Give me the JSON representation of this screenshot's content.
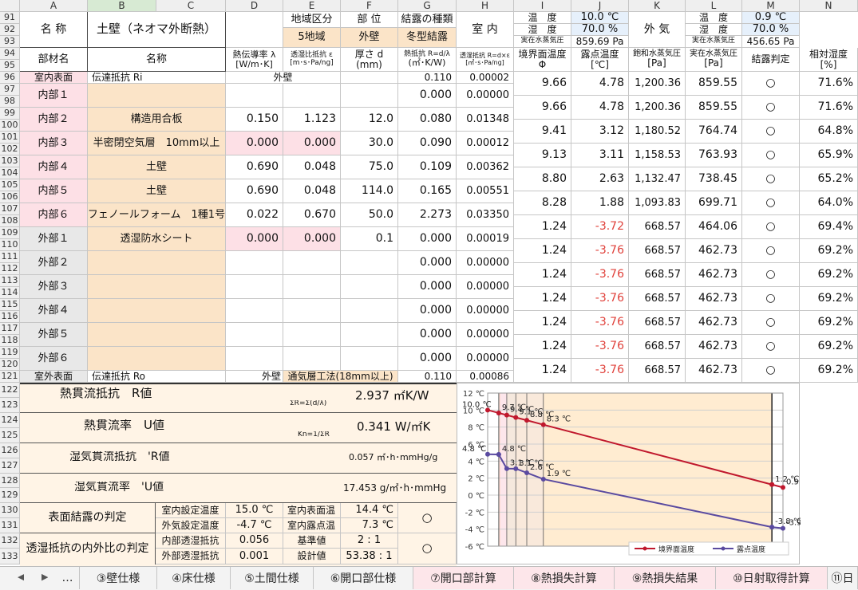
{
  "columns": [
    "A",
    "B",
    "C",
    "D",
    "E",
    "F",
    "G",
    "H",
    "I",
    "J",
    "K",
    "L",
    "M",
    "N"
  ],
  "rows": [
    "91",
    "92",
    "93",
    "94",
    "95",
    "96",
    "97",
    "98",
    "99",
    "100",
    "101",
    "102",
    "103",
    "104",
    "105",
    "106",
    "107",
    "108",
    "109",
    "110",
    "111",
    "112",
    "113",
    "114",
    "115",
    "116",
    "117",
    "118",
    "119",
    "120",
    "121",
    "122",
    "123",
    "124",
    "125",
    "126",
    "127",
    "128",
    "129",
    "130",
    "131",
    "132",
    "133"
  ],
  "header": {
    "name_label": "名 称",
    "wall_name": "土壁（ネオマ外断熱）",
    "region_label": "地域区分",
    "region_value": "5地域",
    "part_label": "部 位",
    "part_value": "外壁",
    "cond_label": "結露の種類",
    "cond_value": "冬型結露",
    "indoor_label": "室 内",
    "indoor_temp_label": "温　度",
    "indoor_temp": "10.0 ℃",
    "indoor_hum_label": "湿　度",
    "indoor_hum": "70.0 %",
    "indoor_vp_label": "実在水蒸気圧",
    "indoor_vp": "859.69 Pa",
    "outdoor_label": "外 気",
    "outdoor_temp_label": "温　度",
    "outdoor_temp": "0.9 ℃",
    "outdoor_hum_label": "湿　度",
    "outdoor_hum": "70.0 %",
    "outdoor_vp_label": "実在水蒸気圧",
    "outdoor_vp": "456.65 Pa"
  },
  "colheads": {
    "member": "部材名",
    "name": "名称",
    "cond1": "熱伝導率 λ",
    "cond2": "[W/m･K]",
    "perm1": "透湿比抵抗 ε",
    "perm2": "[m･s･Pa/ng]",
    "thick1": "厚さ d",
    "thick2": "(mm)",
    "tr1": "熱抵抗 R=d/λ",
    "tr2": "(㎡･K/W)",
    "mr1": "透湿抵抗 R=d×ε",
    "mr2": "[㎡･s･Pa/ng]",
    "itemp1": "境界面温度",
    "itemp2": "Φ",
    "dew1": "露点温度",
    "dew2": "[℃]",
    "sat1": "飽和水蒸気圧",
    "sat2": "[Pa]",
    "act1": "実在水蒸気圧",
    "act2": "[Pa]",
    "judge": "結露判定",
    "rh1": "相対湿度",
    "rh2": "[%]"
  },
  "surf_in": {
    "label": "室内表面",
    "name": "伝達抵抗 Ri",
    "part": "外壁",
    "g": "0.110",
    "h": "0.00002"
  },
  "surf_out": {
    "label": "室外表面",
    "name": "伝達抵抗 Ro",
    "part": "外壁",
    "method": "通気層工法(18mm以上)",
    "g": "0.110",
    "h": "0.00086"
  },
  "materials": [
    {
      "label": "内部１",
      "name": "",
      "d": "",
      "e": "",
      "f": "",
      "g": "0.000",
      "h": "0.00000"
    },
    {
      "label": "内部２",
      "name": "構造用合板",
      "d": "0.150",
      "e": "1.123",
      "f": "12.0",
      "g": "0.080",
      "h": "0.01348"
    },
    {
      "label": "内部３",
      "name": "半密閉空気層　10mm以上",
      "d": "0.000",
      "e": "0.000",
      "f": "30.0",
      "g": "0.090",
      "h": "0.00012"
    },
    {
      "label": "内部４",
      "name": "土壁",
      "d": "0.690",
      "e": "0.048",
      "f": "75.0",
      "g": "0.109",
      "h": "0.00362"
    },
    {
      "label": "内部５",
      "name": "土壁",
      "d": "0.690",
      "e": "0.048",
      "f": "114.0",
      "g": "0.165",
      "h": "0.00551"
    },
    {
      "label": "内部６",
      "name": "フェノールフォーム　1種1号",
      "d": "0.022",
      "e": "0.670",
      "f": "50.0",
      "g": "2.273",
      "h": "0.03350"
    },
    {
      "label": "外部１",
      "name": "透湿防水シート",
      "d": "0.000",
      "e": "0.000",
      "f": "0.1",
      "g": "0.000",
      "h": "0.00019"
    },
    {
      "label": "外部２",
      "name": "",
      "d": "",
      "e": "",
      "f": "",
      "g": "0.000",
      "h": "0.00000"
    },
    {
      "label": "外部３",
      "name": "",
      "d": "",
      "e": "",
      "f": "",
      "g": "0.000",
      "h": "0.00000"
    },
    {
      "label": "外部４",
      "name": "",
      "d": "",
      "e": "",
      "f": "",
      "g": "0.000",
      "h": "0.00000"
    },
    {
      "label": "外部５",
      "name": "",
      "d": "",
      "e": "",
      "f": "",
      "g": "0.000",
      "h": "0.00000"
    },
    {
      "label": "外部６",
      "name": "",
      "d": "",
      "e": "",
      "f": "",
      "g": "0.000",
      "h": "0.00000"
    }
  ],
  "results": [
    {
      "i": "9.66",
      "j": "4.78",
      "k": "1,200.36",
      "l": "859.55",
      "m": "○",
      "n": "71.6%"
    },
    {
      "i": "9.66",
      "j": "4.78",
      "k": "1,200.36",
      "l": "859.55",
      "m": "○",
      "n": "71.6%"
    },
    {
      "i": "9.41",
      "j": "3.12",
      "k": "1,180.52",
      "l": "764.74",
      "m": "○",
      "n": "64.8%"
    },
    {
      "i": "9.13",
      "j": "3.11",
      "k": "1,158.53",
      "l": "763.93",
      "m": "○",
      "n": "65.9%"
    },
    {
      "i": "8.80",
      "j": "2.63",
      "k": "1,132.47",
      "l": "738.45",
      "m": "○",
      "n": "65.2%"
    },
    {
      "i": "8.28",
      "j": "1.88",
      "k": "1,093.83",
      "l": "699.71",
      "m": "○",
      "n": "64.0%"
    },
    {
      "i": "1.24",
      "j": "-3.72",
      "k": "668.57",
      "l": "464.06",
      "m": "○",
      "n": "69.4%"
    },
    {
      "i": "1.24",
      "j": "-3.76",
      "k": "668.57",
      "l": "462.73",
      "m": "○",
      "n": "69.2%"
    },
    {
      "i": "1.24",
      "j": "-3.76",
      "k": "668.57",
      "l": "462.73",
      "m": "○",
      "n": "69.2%"
    },
    {
      "i": "1.24",
      "j": "-3.76",
      "k": "668.57",
      "l": "462.73",
      "m": "○",
      "n": "69.2%"
    },
    {
      "i": "1.24",
      "j": "-3.76",
      "k": "668.57",
      "l": "462.73",
      "m": "○",
      "n": "69.2%"
    },
    {
      "i": "1.24",
      "j": "-3.76",
      "k": "668.57",
      "l": "462.73",
      "m": "○",
      "n": "69.2%"
    },
    {
      "i": "1.24",
      "j": "-3.76",
      "k": "668.57",
      "l": "462.73",
      "m": "○",
      "n": "69.2%"
    }
  ],
  "summary": {
    "r_label": "熱貫流抵抗　R値",
    "r_formula": "ΣR=Σ(d/λ)",
    "r_value": "2.937 ㎡K/W",
    "u_label": "熱貫流率　U値",
    "u_formula": "Kn=1/ΣR",
    "u_value": "0.341 W/㎡K",
    "rr_label": "湿気貫流抵抗　'R値",
    "rr_value": "0.057 ㎡･h･mmHg/g",
    "ru_label": "湿気貫流率　'U値",
    "ru_value": "17.453 g/㎡･h･mmHg",
    "sc_label": "表面結露の判定",
    "sc_in_label": "室内設定温度",
    "sc_in_value": "15.0 ℃",
    "sc_out_label": "外気設定温度",
    "sc_out_value": "-4.7 ℃",
    "sc_surf_label": "室内表面温",
    "sc_surf_value": "14.4 ℃",
    "sc_dew_label": "室内露点温",
    "sc_dew_value": "7.3 ℃",
    "sc_result": "○",
    "pr_label": "透湿抵抗の内外比の判定",
    "pr_in_label": "内部透湿抵抗",
    "pr_in_value": "0.056",
    "pr_out_label": "外部透湿抵抗",
    "pr_out_value": "0.001",
    "pr_std_label": "基準値",
    "pr_std_value": "2 : 1",
    "pr_des_label": "設計値",
    "pr_des_value": "53.38 : 1",
    "pr_result": "○"
  },
  "chart_data": {
    "type": "line",
    "y_ticks": [
      "12 ℃",
      "10 ℃",
      "8 ℃",
      "6 ℃",
      "4 ℃",
      "2 ℃",
      "0 ℃",
      "-2 ℃",
      "-4 ℃",
      "-6 ℃"
    ],
    "ylim": [
      -6,
      12
    ],
    "x": [
      0,
      0.11,
      0.11,
      0.19,
      0.28,
      0.389,
      0.554,
      2.827,
      2.827,
      2.937
    ],
    "series": [
      {
        "name": "境界面温度",
        "color": "#c0182d",
        "values": [
          10.0,
          9.66,
          9.66,
          9.41,
          9.13,
          8.8,
          8.28,
          1.24,
          1.24,
          0.9
        ],
        "labels": [
          "10.0 ℃",
          "",
          "9.7 ℃",
          "9.4 ℃",
          "9.1 ℃",
          "8.8 ℃",
          "8.3 ℃",
          "1.2 ℃",
          "",
          "0.9 ℃"
        ]
      },
      {
        "name": "露点温度",
        "color": "#5a4aa0",
        "values": [
          4.8,
          4.78,
          4.78,
          3.12,
          3.11,
          2.63,
          1.88,
          -3.76,
          -3.76,
          -3.9
        ],
        "labels": [
          "4.8 ℃",
          "",
          "4.8 ℃",
          "3.1 ℃",
          "3.1 ℃",
          "2.6 ℃",
          "1.9 ℃",
          "-3.8 ℃",
          "",
          "-3.9 ℃"
        ]
      }
    ]
  },
  "tabs": [
    {
      "label": "…"
    },
    {
      "label": "③壁仕様"
    },
    {
      "label": "④床仕様"
    },
    {
      "label": "⑤土間仕様"
    },
    {
      "label": "⑥開口部仕様"
    },
    {
      "label": "⑦開口部計算"
    },
    {
      "label": "⑧熱損失計算"
    },
    {
      "label": "⑨熱損失結果"
    },
    {
      "label": "⑩日射取得計算"
    },
    {
      "label": "⑪日"
    }
  ]
}
